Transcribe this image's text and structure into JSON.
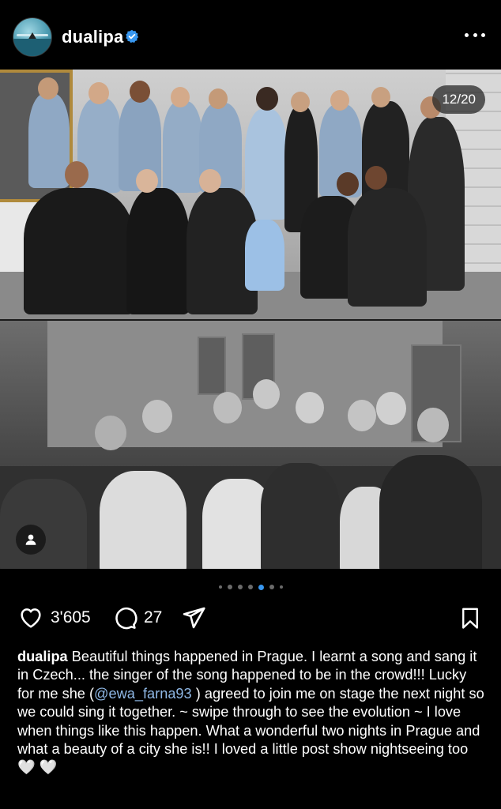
{
  "header": {
    "username": "dualipa",
    "verified": true,
    "avatar_icon": "profile-avatar",
    "more_icon": "more-dots-icon"
  },
  "carousel": {
    "counter": "12/20",
    "current_index": 12,
    "total": 20,
    "tag_icon": "user-tag-icon"
  },
  "actions": {
    "likes": "3'605",
    "comments": "27",
    "like_icon": "heart-outline-icon",
    "comment_icon": "comment-bubble-icon",
    "share_icon": "send-icon",
    "save_icon": "bookmark-icon"
  },
  "caption": {
    "username": "dualipa",
    "text_before": "Beautiful things happened in Prague. I learnt a song and sang it in Czech... the singer of the song happened to be in the crowd!!! Lucky for me she (",
    "mention": "@ewa_farna93",
    "text_after": " ) agreed to join me on stage the next night so we could sing it together. ~ swipe through to see the evolution ~ I love when things like this happen. What a wonderful two nights in Prague and what a beauty of a city she is!! I loved a little post show nightseeing too",
    "emoji": "🤍 🤍"
  },
  "colors": {
    "background": "#000000",
    "mention": "#8fb8e6",
    "active_dot": "#3897f0",
    "verified": "#3897f0"
  }
}
